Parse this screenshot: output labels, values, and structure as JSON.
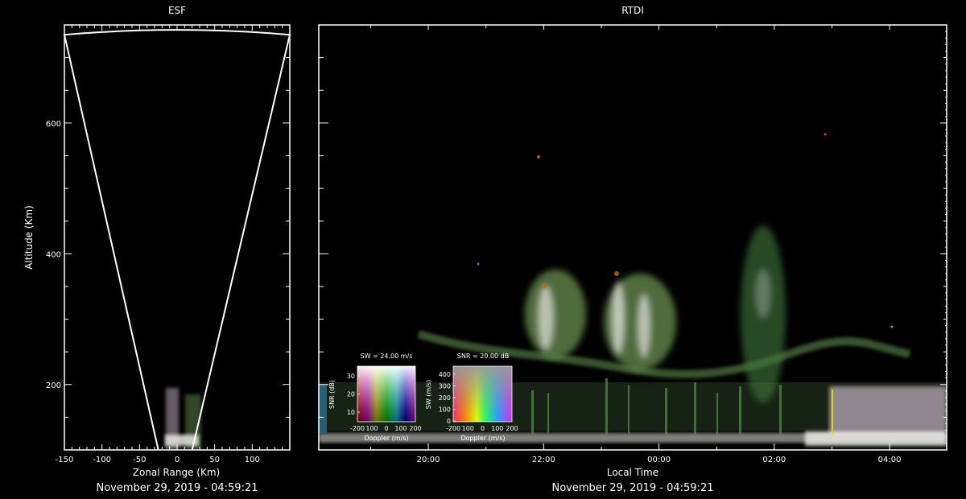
{
  "chart_data": [
    {
      "type": "heatmap",
      "title": "ESF",
      "xlabel": "Zonal Range (Km)",
      "ylabel": "Altitude (Km)",
      "footer": "November 29, 2019 - 04:59:21",
      "xlim": [
        -150,
        150
      ],
      "ylim": [
        100,
        750
      ],
      "x_tick_labels": [
        "-150",
        "-100",
        "-50",
        "0",
        "50",
        "100"
      ],
      "x_tick_values": [
        -150,
        -100,
        -50,
        0,
        50,
        100
      ],
      "y_tick_labels": [
        "200",
        "400",
        "600"
      ],
      "y_tick_values": [
        200,
        400,
        600
      ],
      "beam_edges": {
        "left_top": [
          -150,
          735
        ],
        "right_top": [
          150,
          735
        ],
        "left_bottom": [
          -25,
          100
        ],
        "right_bottom": [
          20,
          100
        ]
      },
      "echo_region": {
        "x": [
          -20,
          30
        ],
        "altitude": [
          100,
          200
        ]
      }
    },
    {
      "type": "heatmap",
      "title": "RTDI",
      "xlabel": "Local Time",
      "footer": "November 29, 2019 - 04:59:21",
      "x_tick_labels": [
        "20:00",
        "22:00",
        "00:00",
        "02:00",
        "04:00"
      ],
      "x_hours": [
        20,
        22,
        24,
        26,
        28
      ],
      "xlim_hours": [
        18.1,
        28.99
      ],
      "ylim": [
        100,
        750
      ],
      "y_tick_values": [
        200,
        400,
        600
      ],
      "echo_regions": [
        {
          "time_hours": [
            18.1,
            28.99
          ],
          "altitude": [
            100,
            200
          ],
          "label": "bottom echo band"
        },
        {
          "time_hours": [
            22.0,
            23.1
          ],
          "altitude": [
            250,
            380
          ],
          "label": "plume cluster"
        },
        {
          "time_hours": [
            23.2,
            24.2
          ],
          "altitude": [
            200,
            390
          ],
          "label": "plume cluster"
        },
        {
          "time_hours": [
            25.8,
            26.9
          ],
          "altitude": [
            200,
            490
          ],
          "label": "tall plume"
        }
      ]
    }
  ],
  "colorbars": [
    {
      "title": "SW = 24.00 m/s",
      "ylabel": "SNR (dB)",
      "xlabel": "Doppler (m/s)",
      "y_tick_labels": [
        "30",
        "20",
        "10"
      ],
      "x_tick_labels": [
        "-200",
        "100",
        "0",
        "100",
        "200"
      ]
    },
    {
      "title": "SNR = 20.00 dB",
      "ylabel": "SW (m/s)",
      "xlabel": "Doppler (m/s)",
      "y_tick_labels": [
        "400",
        "300",
        "200",
        "100",
        "0"
      ],
      "x_tick_labels": [
        "-200",
        "100",
        "0",
        "100",
        "200"
      ]
    }
  ],
  "colors": {
    "background": "#000000",
    "axes": "#ffffff",
    "echo_green": "#6f9a55",
    "echo_white": "#e6e6de",
    "echo_magenta": "#cc88c6"
  }
}
